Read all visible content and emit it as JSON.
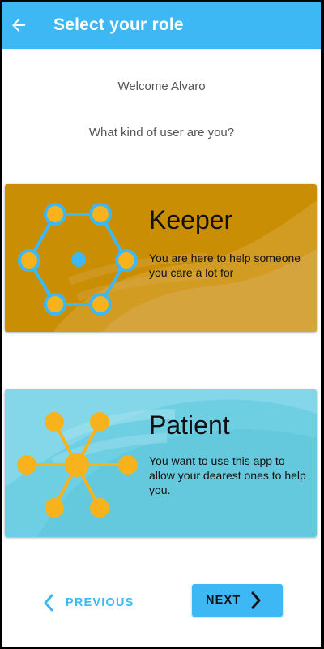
{
  "appbar": {
    "title": "Select your role",
    "back_icon": "arrow-left-icon",
    "color": "#3db8f5"
  },
  "welcome_text": "Welcome Alvaro",
  "question_text": "What kind of user are you?",
  "roles": [
    {
      "title": "Keeper",
      "description": "You are here to help someone you care a lot for",
      "icon": "ring-network-icon",
      "background": "#c98e04"
    },
    {
      "title": "Patient",
      "description": "You want to use this app to allow your dearest ones to help you.",
      "icon": "star-network-icon",
      "background": "#6ecfe3"
    }
  ],
  "nav": {
    "previous_label": "PREVIOUS",
    "next_label": "NEXT",
    "accent": "#3db8f5",
    "node_color": "#f7b21c"
  }
}
